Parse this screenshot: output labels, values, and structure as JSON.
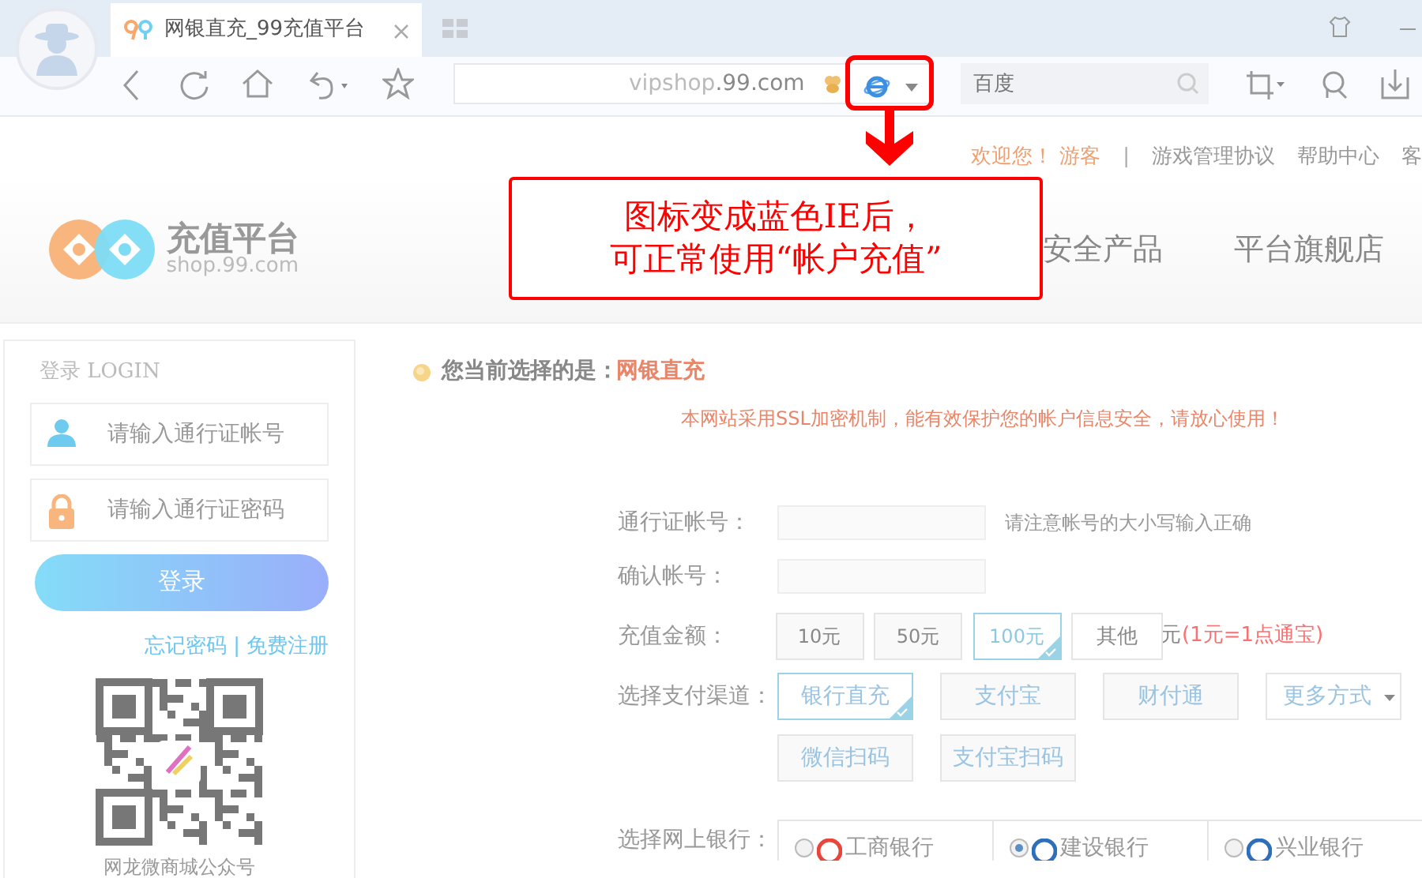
{
  "browser": {
    "tab_title": "网银直充_99充值平台",
    "url": "vipshop.99.com",
    "search_placeholder": "百度"
  },
  "annotation": {
    "lines": [
      "图标变成蓝色IE后，",
      "可正常使用“帐户充值”"
    ]
  },
  "top_bar": {
    "welcome": "欢迎您！",
    "user": "游客",
    "separator": "|",
    "links": [
      "游戏管理协议",
      "帮助中心",
      "客"
    ]
  },
  "logo": {
    "name": "充值平台",
    "domain": "shop.99.com"
  },
  "nav": [
    "安全产品",
    "平台旗舰店"
  ],
  "login": {
    "title": "登录 LOGIN",
    "fields": [
      {
        "kind": "user",
        "placeholder": "请输入通行证帐号"
      },
      {
        "kind": "lock",
        "placeholder": "请输入通行证密码"
      }
    ],
    "button": "登录",
    "links": [
      "忘记密码",
      "免费注册"
    ],
    "separator": "|",
    "qr_caption": "网龙微商城公众号"
  },
  "selection": {
    "label": "您当前选择的是：",
    "value": "网银直充"
  },
  "notice": "本网站采用SSL加密机制，能有效保护您的帐户信息安全，请放心使用！",
  "form": {
    "account": {
      "label": "通行证帐号：",
      "hint": "请注意帐号的大小写输入正确"
    },
    "confirm": {
      "label": "确认帐号："
    },
    "amount": {
      "label": "充值金额：",
      "options": [
        {
          "kind": "button",
          "label": "10元",
          "selected": false
        },
        {
          "kind": "button",
          "label": "50元",
          "selected": false
        },
        {
          "kind": "button",
          "label": "100元",
          "selected": true
        },
        {
          "kind": "input",
          "label": "其他",
          "selected": false
        }
      ],
      "unit": "元",
      "rate": "(1元=1点通宝)"
    },
    "channels": {
      "label": "选择支付渠道：",
      "options": [
        {
          "kind": "button",
          "label": "银行直充",
          "selected": true
        },
        {
          "kind": "button",
          "label": "支付宝",
          "selected": false
        },
        {
          "kind": "button",
          "label": "财付通",
          "selected": false
        },
        {
          "kind": "dropdown",
          "label": "更多方式",
          "selected": false
        },
        {
          "kind": "button",
          "label": "微信扫码",
          "selected": false
        },
        {
          "kind": "button",
          "label": "支付宝扫码",
          "selected": false
        }
      ]
    },
    "banks": {
      "label": "选择网上银行：",
      "options": [
        {
          "name": "工商银行",
          "color": "#e8453c",
          "selected": false
        },
        {
          "name": "建设银行",
          "color": "#2f6eba",
          "selected": true
        },
        {
          "name": "兴业银行",
          "color": "#2f6eba",
          "selected": false
        }
      ]
    }
  }
}
